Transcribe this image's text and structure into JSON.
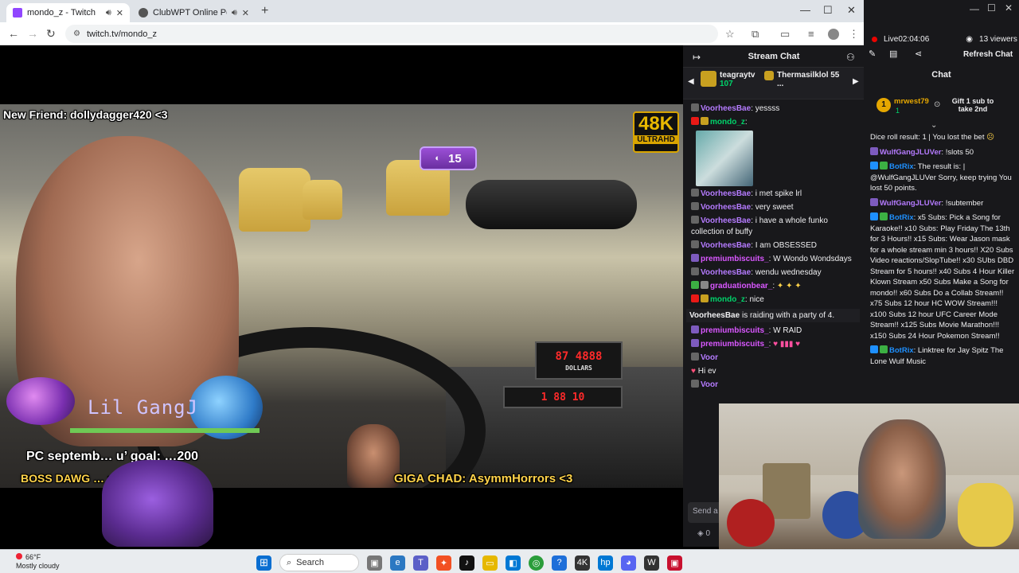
{
  "browser": {
    "tabs": [
      {
        "label": "mondo_z - Twitch",
        "color": "#9146ff"
      },
      {
        "label": "ClubWPT Online Poker and",
        "color": "#555555"
      }
    ],
    "url": "twitch.tv/mondo_z"
  },
  "video": {
    "viewer_pill": "15",
    "badge_big": "48K",
    "badge_small": "ULTRAHD",
    "new_friend": "New Friend: dollydagger420 <3",
    "lil_gang_name": "Lil GangJ",
    "goal_text": "PC septemb… u’ goal: …200",
    "boss_dawg": "BOSS DAWG … sBae - 10 Bits <3",
    "giga_chad": "GIGA CHAD: AsymmHorrors <3",
    "meter_top": "87   4888",
    "meter_label": "DOLLARS",
    "meter_bottom": "1   88    10"
  },
  "stream_chat": {
    "title": "Stream Chat",
    "pinned": [
      {
        "name": "teagraytv",
        "count": "107"
      },
      {
        "name": "Thermasilklol",
        "count": "55",
        "extra": "..."
      }
    ],
    "messages": [
      {
        "user": "VoorheesBae",
        "text": "yessss",
        "color": "#b57bff"
      },
      {
        "user": "mondo_z",
        "text": "",
        "color": "#00d26a",
        "image": true
      },
      {
        "user": "VoorheesBae",
        "text": "i met spike lrl",
        "color": "#b57bff"
      },
      {
        "user": "VoorheesBae",
        "text": "very sweet",
        "color": "#b57bff"
      },
      {
        "user": "VoorheesBae",
        "text": "i have a whole funko collection of buffy",
        "color": "#b57bff"
      },
      {
        "user": "VoorheesBae",
        "text": "I am OBSESSED",
        "color": "#b57bff"
      },
      {
        "user": "premiumbiscuits_",
        "text": "W Wondo Wondsdays",
        "color": "#d957ff"
      },
      {
        "user": "VoorheesBae",
        "text": "wendu wednesday",
        "color": "#b57bff"
      },
      {
        "user": "graduationbear_",
        "text": "",
        "color": "#d957ff"
      },
      {
        "user": "mondo_z",
        "text": "nice",
        "color": "#00d26a"
      }
    ],
    "raid_user": "VoorheesBae",
    "raid_text": "is raiding with a party of 4.",
    "after_raid": [
      {
        "user": "premiumbiscuits_",
        "text": "W RAID",
        "color": "#d957ff"
      },
      {
        "user": "premiumbiscuits_",
        "text": "",
        "color": "#d957ff"
      },
      {
        "user": "Voor",
        "text": "",
        "color": "#b57bff"
      },
      {
        "user": "",
        "text": "Hi ev",
        "color": "#efeff1"
      },
      {
        "user": "Voor",
        "text": "",
        "color": "#b57bff"
      }
    ],
    "send_placeholder": "Send a",
    "points": "0"
  },
  "right_panel": {
    "live": "Live",
    "uptime": "02:04:06",
    "viewers": "13 viewers",
    "refresh": "Refresh Chat",
    "chat_title": "Chat",
    "pinned_user": "mrwest79",
    "pinned_count": "1",
    "gift_text": "Gift 1 sub to take 2nd",
    "messages": [
      {
        "user": "",
        "text": "Dice roll result: 1 | You lost the bet",
        "color": "#efeff1"
      },
      {
        "user": "WulfGangJLUVer",
        "text": "!slots 50",
        "color": "#b57bff"
      },
      {
        "user": "BotRix",
        "text": "The result is: | @WulfGangJLUVer Sorry, keep trying You lost 50 points.",
        "color": "#1e90ff"
      },
      {
        "user": "WulfGangJLUVer",
        "text": "!subtember",
        "color": "#b57bff"
      },
      {
        "user": "BotRix",
        "text": "x5 Subs: Pick a Song for Karaoke!! x10 Subs: Play Friday The 13th for 3 Hours!! x15 Subs: Wear Jason mask for a whole stream min 3 hours!! X20 Subs Video reactions/SlopTube!! x30 SUbs DBD Stream for 5 hours!! x40 Subs 4 Hour Killer Klown Stream x50 Subs Make a Song for mondo!! x60 Subs Do a Collab Stream!! x75 Subs 12 hour HC WOW Stream!!! x100 Subs 12 hour UFC Career Mode Stream!! x125 Subs Movie Marathon!!! x150 Subs 24 Hour Pokemon Stream!!",
        "color": "#1e90ff"
      },
      {
        "user": "BotRix",
        "text": "Linktree for Jay Spitz The Lone Wulf Music",
        "color": "#1e90ff"
      }
    ]
  },
  "taskbar": {
    "temp": "66°F",
    "weather": "Mostly cloudy",
    "search": "Search"
  }
}
